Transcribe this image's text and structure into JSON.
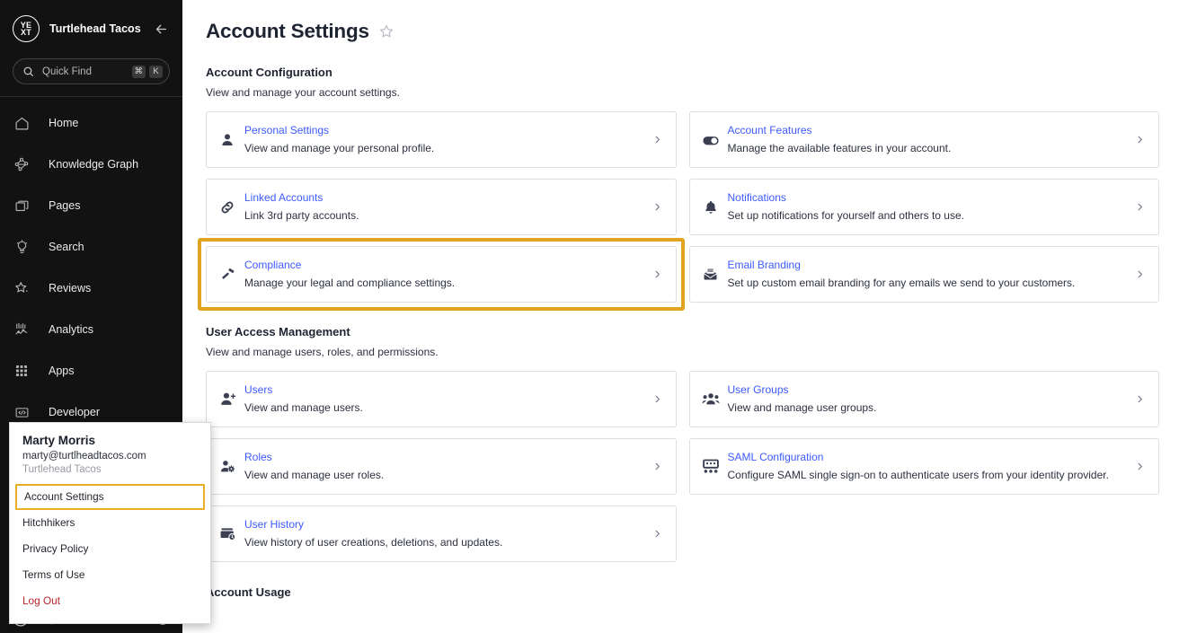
{
  "sidebar": {
    "brand": {
      "logo_line1": "YE",
      "logo_line2": "XT",
      "name": "Turtlehead Tacos",
      "collapse_icon": "arrow-left-icon"
    },
    "quick_find": {
      "placeholder": "Quick Find",
      "value": "",
      "icon": "search-icon",
      "shortcut_keys": [
        "⌘",
        "K"
      ]
    },
    "items": [
      {
        "label": "Home",
        "icon": "home-icon"
      },
      {
        "label": "Knowledge Graph",
        "icon": "knowledge-graph-icon"
      },
      {
        "label": "Pages",
        "icon": "pages-icon"
      },
      {
        "label": "Search",
        "icon": "lightbulb-icon"
      },
      {
        "label": "Reviews",
        "icon": "star-icon"
      },
      {
        "label": "Analytics",
        "icon": "analytics-icon"
      },
      {
        "label": "Apps",
        "icon": "apps-grid-icon"
      },
      {
        "label": "Developer",
        "icon": "code-icon"
      }
    ],
    "footer": {
      "avatar_icon": "avatar-icon",
      "help_icon": "question-circle-icon"
    }
  },
  "user_menu": {
    "name": "Marty Morris",
    "email": "marty@turtlheadtacos.com",
    "org": "Turtlehead Tacos",
    "items": [
      {
        "label": "Account Settings",
        "highlighted": true
      },
      {
        "label": "Hitchhikers",
        "highlighted": false
      },
      {
        "label": "Privacy Policy",
        "highlighted": false
      },
      {
        "label": "Terms of Use",
        "highlighted": false
      },
      {
        "label": "Log Out",
        "highlighted": false,
        "danger": true
      }
    ]
  },
  "header": {
    "title": "Account Settings",
    "star_icon": "star-outline-icon"
  },
  "sections": [
    {
      "title": "Account Configuration",
      "subtitle": "View and manage your account settings.",
      "cards": [
        {
          "title": "Personal Settings",
          "desc": "View and manage your personal profile.",
          "icon": "person-icon",
          "highlighted": false
        },
        {
          "title": "Account Features",
          "desc": "Manage the available features in your account.",
          "icon": "toggle-icon",
          "highlighted": false
        },
        {
          "title": "Linked Accounts",
          "desc": "Link 3rd party accounts.",
          "icon": "link-icon",
          "highlighted": false
        },
        {
          "title": "Notifications",
          "desc": "Set up notifications for yourself and others to use.",
          "icon": "bell-icon",
          "highlighted": false
        },
        {
          "title": "Compliance",
          "desc": "Manage your legal and compliance settings.",
          "icon": "gavel-icon",
          "highlighted": true
        },
        {
          "title": "Email Branding",
          "desc": "Set up custom email branding for any emails we send to your customers.",
          "icon": "email-icon",
          "highlighted": false
        }
      ]
    },
    {
      "title": "User Access Management",
      "subtitle": "View and manage users, roles, and permissions.",
      "cards": [
        {
          "title": "Users",
          "desc": "View and manage users.",
          "icon": "user-add-icon",
          "highlighted": false
        },
        {
          "title": "User Groups",
          "desc": "View and manage user groups.",
          "icon": "user-group-icon",
          "highlighted": false
        },
        {
          "title": "Roles",
          "desc": "View and manage user roles.",
          "icon": "user-gear-icon",
          "highlighted": false
        },
        {
          "title": "SAML Configuration",
          "desc": "Configure SAML single sign-on to authenticate users from your identity provider.",
          "icon": "saml-icon",
          "highlighted": false
        },
        {
          "title": "User History",
          "desc": "View history of user creations, deletions, and updates.",
          "icon": "history-icon",
          "highlighted": false
        }
      ]
    }
  ],
  "usage_section": {
    "title": "Account Usage"
  },
  "colors": {
    "accent_link": "#3d5afe",
    "highlight": "#E0A420",
    "sidebar_bg": "#121212",
    "logout": "#b4252b"
  }
}
